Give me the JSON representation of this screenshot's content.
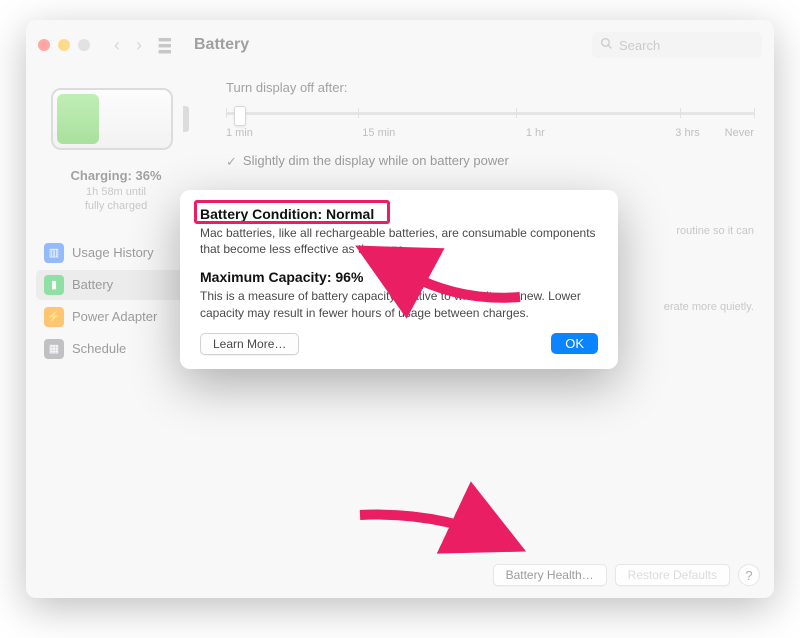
{
  "toolbar": {
    "title": "Battery",
    "search_placeholder": "Search"
  },
  "sidebar": {
    "charge_status": "Charging: 36%",
    "charge_sub_line1": "1h 58m until",
    "charge_sub_line2": "fully charged",
    "items": [
      {
        "label": "Usage History"
      },
      {
        "label": "Battery"
      },
      {
        "label": "Power Adapter"
      },
      {
        "label": "Schedule"
      }
    ]
  },
  "main": {
    "display_off_label": "Turn display off after:",
    "slider_ticks": [
      "1 min",
      "15 min",
      "1 hr",
      "3 hrs",
      "Never"
    ],
    "check1": "Slightly dim the display while on battery power",
    "check2_sub": "routine so it can",
    "check3_sub": "erate more quietly.",
    "battery_health_btn": "Battery Health…",
    "restore_btn": "Restore Defaults",
    "help": "?"
  },
  "modal": {
    "cond_heading": "Battery Condition: Normal",
    "cond_body": "Mac batteries, like all rechargeable batteries, are consumable components that become less effective as they age.",
    "cap_heading": "Maximum Capacity: 96%",
    "cap_body": "This is a measure of battery capacity relative to when it was new. Lower capacity may result in fewer hours of usage between charges.",
    "learn_more": "Learn More…",
    "ok": "OK"
  }
}
